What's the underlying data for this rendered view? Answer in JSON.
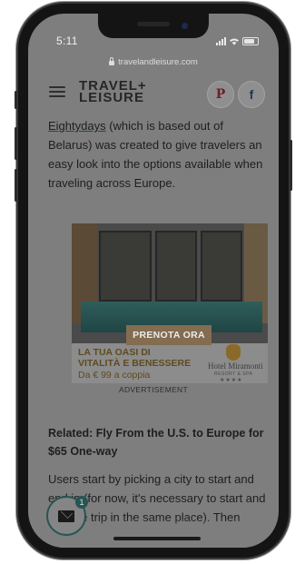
{
  "status": {
    "time": "5:11"
  },
  "browser": {
    "url": "travelandleisure.com"
  },
  "header": {
    "logo_line1": "TRAVEL+",
    "logo_line2": "LEISURE",
    "pinterest_glyph": "P",
    "facebook_glyph": "f"
  },
  "article": {
    "intro_link": "Eightydays",
    "intro_rest": " (which is based out of Belarus) was created to give travelers an easy look into the options available when traveling across Europe.",
    "related": "Related: Fly From the U.S. to Europe for $65 One-way",
    "para2": "Users start by picking a city to start and end in (for now, it's necessary to start and end the trip in the same place). Then"
  },
  "ad": {
    "cta": "PRENOTA ORA",
    "tagline_line1": "LA TUA OASI DI",
    "tagline_line2": "VITALITÀ E BENESSERE",
    "price": "Da € 99 a coppia",
    "hotel": "Hotel Miramonti",
    "hotel_sub": "RESORT & SPA",
    "stars": "★★★★",
    "label": "ADVERTISEMENT"
  },
  "mail": {
    "badge": "1"
  },
  "icons": {
    "menu": "hamburger-icon",
    "lock": "lock-icon",
    "mail": "envelope-icon",
    "pinterest": "pinterest-icon",
    "facebook": "facebook-icon"
  }
}
